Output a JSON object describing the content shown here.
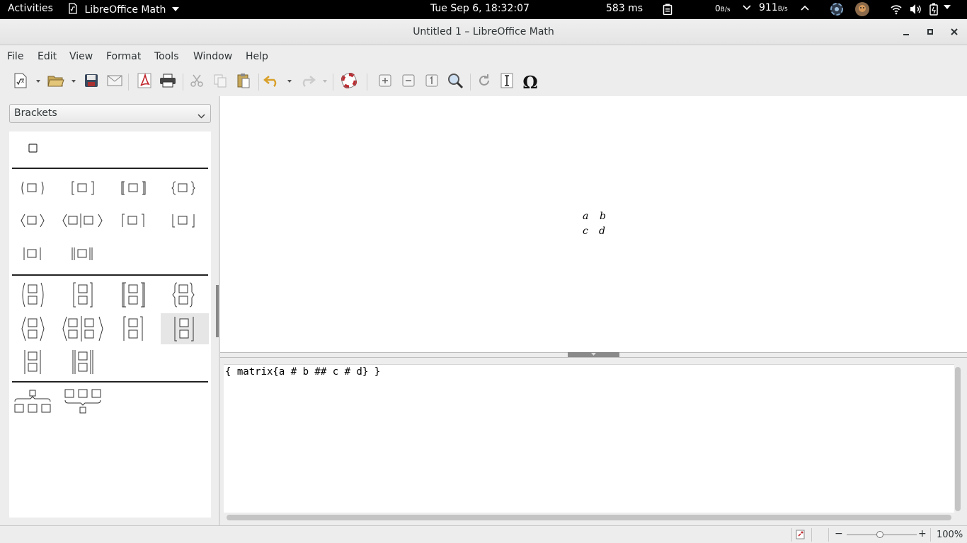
{
  "topbar": {
    "activities": "Activities",
    "app_menu": "LibreOffice Math",
    "clock": "Tue Sep  6, 18:32:07",
    "latency": "583 ms",
    "net_up_value": "0",
    "net_up_unit": "B/s",
    "net_down_value": "911",
    "net_down_unit": "B/s"
  },
  "window": {
    "title": "Untitled 1 – LibreOffice Math"
  },
  "menubar": {
    "items": [
      "File",
      "Edit",
      "View",
      "Format",
      "Tools",
      "Window",
      "Help"
    ]
  },
  "toolbar": {
    "omega": "Ω"
  },
  "sidebar": {
    "category": "Brackets"
  },
  "preview": {
    "matrix": [
      [
        "a",
        "b"
      ],
      [
        "c",
        "d"
      ]
    ]
  },
  "editor": {
    "command": "{ matrix{a # b ## c # d} }"
  },
  "statusbar": {
    "zoom_minus": "−",
    "zoom_plus": "+",
    "zoom": "100%"
  },
  "colors": {
    "topbar_bg": "#000000",
    "window_bg": "#ededed",
    "undo_arrow": "#e8b13a",
    "print_icon_red": "#c0282e"
  }
}
